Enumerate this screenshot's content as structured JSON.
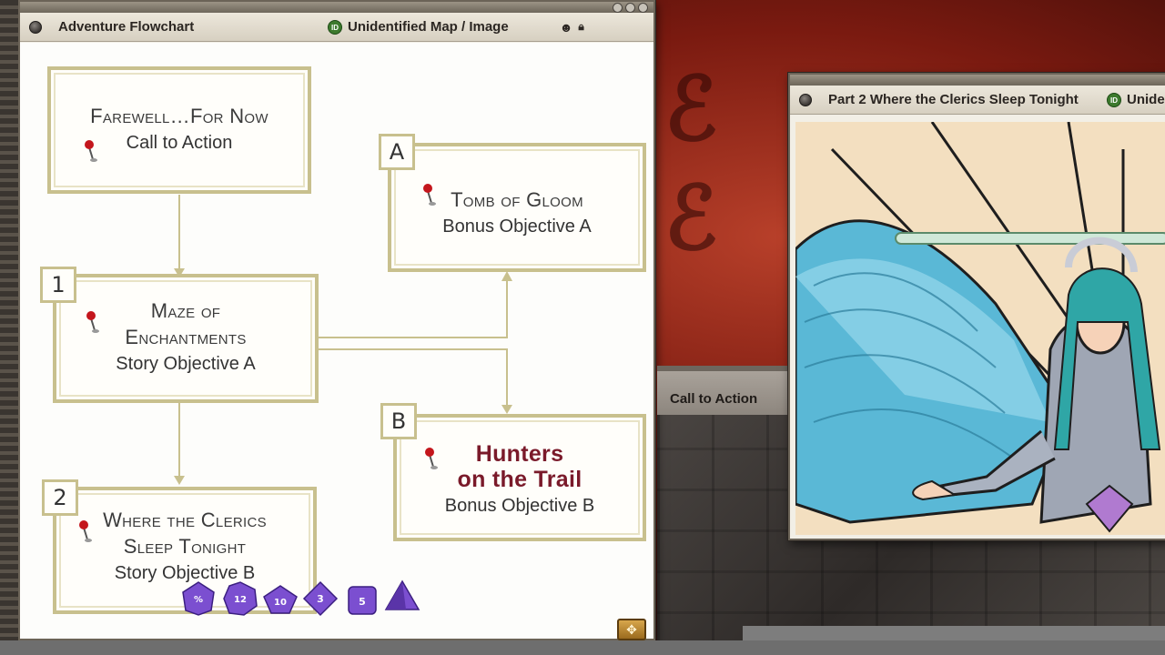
{
  "flowchart_window": {
    "title": "Adventure Flowchart",
    "id_badge": "ID",
    "link_title": "Unidentified Map / Image",
    "icons": [
      "mask-icon",
      "lock-icon",
      "help-icon",
      "resize-icon",
      "close-icon"
    ]
  },
  "nodes": {
    "farewell": {
      "title": "Farewell…For Now",
      "subtitle": "Call to Action"
    },
    "maze": {
      "label": "1",
      "title_line1": "Maze of",
      "title_line2": "Enchantments",
      "subtitle": "Story Objective A"
    },
    "clerics": {
      "label": "2",
      "title_line1": "Where the Clerics",
      "title_line2": "Sleep Tonight",
      "subtitle": "Story Objective B"
    },
    "tomb": {
      "label": "A",
      "title": "Tomb of Gloom",
      "subtitle": "Bonus Objective A"
    },
    "hunters": {
      "label": "B",
      "title_line1": "Hunters",
      "title_line2": "on the Trail",
      "subtitle": "Bonus Objective B"
    }
  },
  "image_window": {
    "title": "Part 2 Where the Clerics Sleep Tonight",
    "id_badge": "ID",
    "link_title": "Unide"
  },
  "call_to_action_panel": {
    "label": "Call to Action"
  },
  "dice": [
    "d%",
    "d12",
    "d10",
    "d8",
    "d6",
    "d4"
  ],
  "dice_faces": [
    "%",
    "12",
    "10",
    "3",
    "5",
    ""
  ],
  "colors": {
    "node_border": "#c8c08e",
    "connector": "#c8c08e",
    "hunters_title": "#7a1a2a",
    "dice": "#7b4fd0",
    "id_badge": "#3d7a2d"
  }
}
